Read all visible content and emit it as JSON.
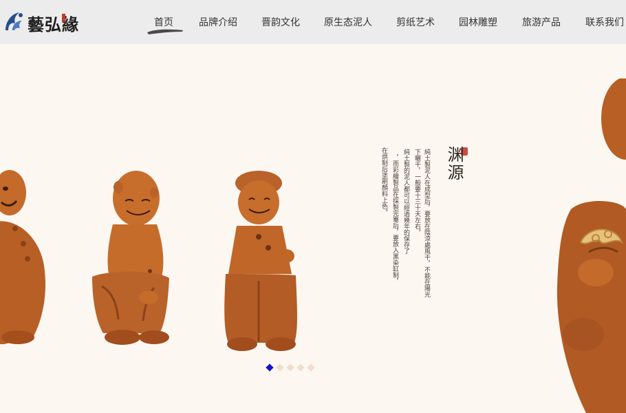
{
  "header": {
    "logo_text": "藝弘緣",
    "nav": [
      {
        "label": "首页",
        "active": true
      },
      {
        "label": "品牌介绍"
      },
      {
        "label": "晋韵文化"
      },
      {
        "label": "原生态泥人"
      },
      {
        "label": "剪纸艺术"
      },
      {
        "label": "园林雕塑"
      },
      {
        "label": "旅游产品"
      },
      {
        "label": "联系我们"
      }
    ]
  },
  "hero": {
    "poem": {
      "title": "渊源",
      "columns": [
        "純土製泥人在成型后，要放在陰涼處風干，不能在陽光",
        "下曬干，一般要十三十天左右。",
        "純土製的泥人都可以經過幾年的保存了",
        "，而彩繪製品在採製完畢后，要放入黑染缸制，",
        "在烘制后塗刷顏料上色。"
      ]
    },
    "slider": {
      "count": 5,
      "active_index": 0
    }
  },
  "colors": {
    "header_bg": "#ececec",
    "page_bg": "#fdf7f2",
    "clay": "#c46a2a",
    "active_dot": "#1111d8"
  }
}
